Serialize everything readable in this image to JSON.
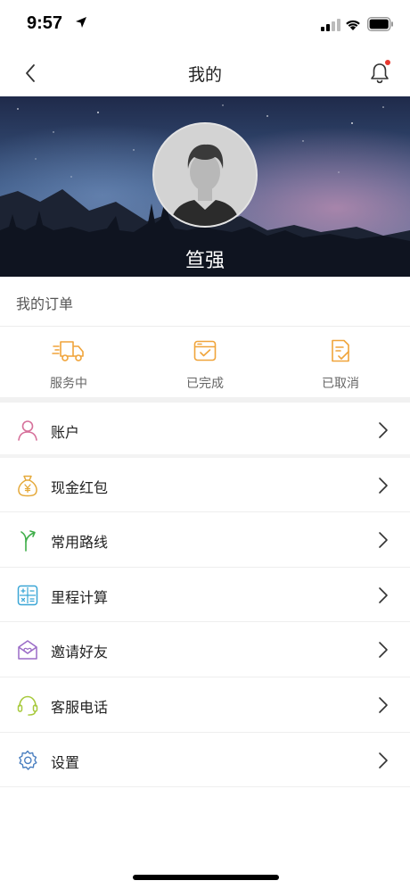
{
  "status_bar": {
    "time": "9:57"
  },
  "nav": {
    "title": "我的"
  },
  "profile": {
    "username": "笪强"
  },
  "orders": {
    "title": "我的订单",
    "items": [
      {
        "label": "服务中",
        "icon": "truck-icon"
      },
      {
        "label": "已完成",
        "icon": "calendar-check-icon"
      },
      {
        "label": "已取消",
        "icon": "document-check-icon"
      }
    ]
  },
  "menu": {
    "items": [
      {
        "label": "账户",
        "icon": "user-icon"
      },
      {
        "label": "现金红包",
        "icon": "money-bag-icon"
      },
      {
        "label": "常用路线",
        "icon": "route-icon"
      },
      {
        "label": "里程计算",
        "icon": "calculator-icon"
      },
      {
        "label": "邀请好友",
        "icon": "invite-envelope-icon"
      },
      {
        "label": "客服电话",
        "icon": "headset-icon"
      },
      {
        "label": "设置",
        "icon": "gear-icon"
      }
    ]
  },
  "colors": {
    "order_icon": "#f0a43a",
    "user_icon": "#d6709a",
    "money_icon": "#e5a93a",
    "route_icon": "#3fae49",
    "calc_icon": "#3aa6d6",
    "invite_icon": "#9b6cc7",
    "headset_icon": "#a6c93a",
    "gear_icon": "#4a7fc0"
  }
}
